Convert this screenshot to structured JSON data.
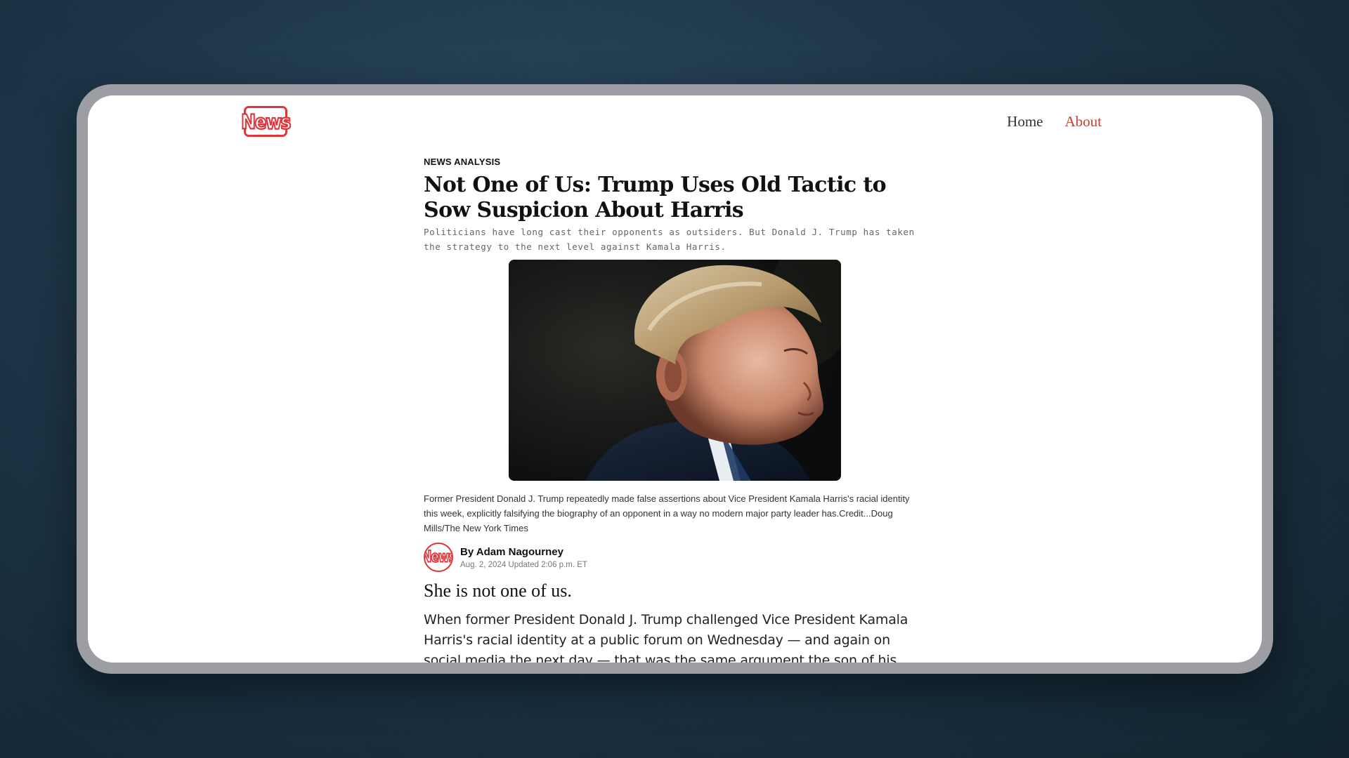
{
  "header": {
    "logo_text": "News",
    "nav": {
      "home": "Home",
      "about": "About"
    }
  },
  "article": {
    "kicker": "NEWS ANALYSIS",
    "headline": "Not One of Us: Trump Uses Old Tactic to Sow Suspicion About Harris",
    "dek": "Politicians have long cast their opponents as outsiders. But Donald J. Trump has taken the strategy to the next level against Kamala Harris.",
    "caption": "Former President Donald J. Trump repeatedly made false assertions about Vice President Kamala Harris's racial identity this week, explicitly falsifying the biography of an opponent in a way no modern major party leader has.Credit...Doug Mills/The New York Times",
    "author": {
      "avatar_text": "News",
      "name": "By Adam Nagourney",
      "date": "Aug. 2, 2024 Updated 2:06 p.m. ET"
    },
    "lead": "She is not one of us.",
    "body": "When former President Donald J. Trump challenged Vice President Kamala Harris's racial identity at a public forum on Wednesday — and again on social media the next day — that was the same argument the son of his"
  },
  "colors": {
    "brand_red": "#e0363b",
    "nav_active": "#c6412f",
    "background": "#1b3446",
    "frame": "#9c9ea3"
  }
}
